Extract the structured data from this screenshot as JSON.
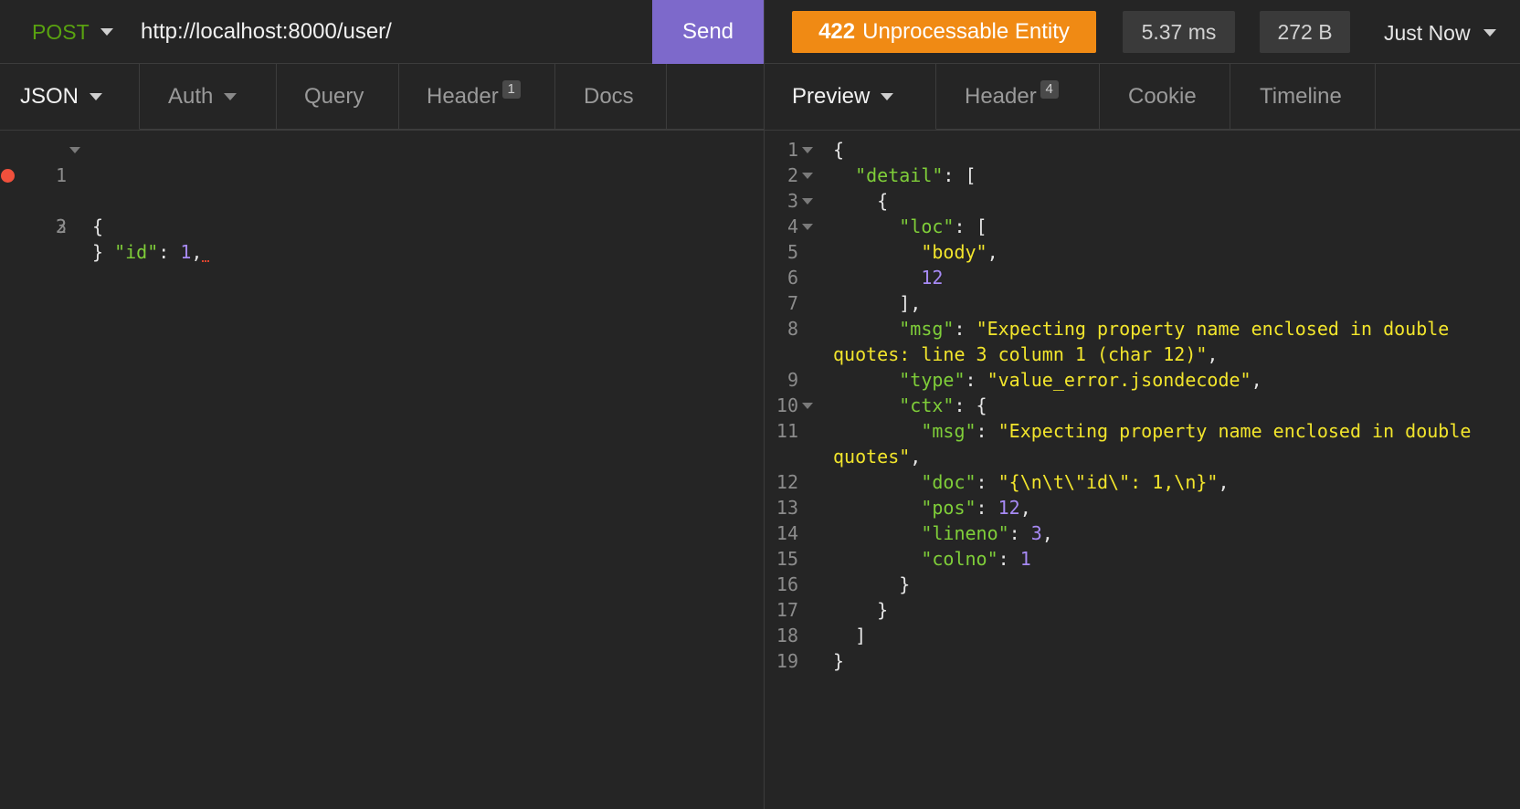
{
  "request": {
    "method": "POST",
    "url": "http://localhost:8000/user/",
    "send_label": "Send",
    "tabs": [
      {
        "label": "JSON"
      },
      {
        "label": "Auth"
      },
      {
        "label": "Query"
      },
      {
        "label": "Header",
        "badge": "1"
      },
      {
        "label": "Docs"
      }
    ],
    "body_lines": [
      {
        "num": "1",
        "text": "{"
      },
      {
        "num": "2",
        "key": "\"id\"",
        "sep": ": ",
        "value": "1",
        "trail": ","
      },
      {
        "num": "3",
        "text": "}"
      }
    ]
  },
  "response": {
    "status_code": "422",
    "status_text": "Unprocessable Entity",
    "time": "5.37 ms",
    "size": "272 B",
    "history": "Just Now",
    "tabs": [
      {
        "label": "Preview"
      },
      {
        "label": "Header",
        "badge": "4"
      },
      {
        "label": "Cookie"
      },
      {
        "label": "Timeline"
      }
    ],
    "lines": [
      {
        "num": "1",
        "fold": true,
        "indent": "",
        "parts": [
          [
            "p",
            "{"
          ]
        ]
      },
      {
        "num": "2",
        "fold": true,
        "indent": "  ",
        "parts": [
          [
            "k",
            "\"detail\""
          ],
          [
            "p",
            ": ["
          ]
        ]
      },
      {
        "num": "3",
        "fold": true,
        "indent": "    ",
        "parts": [
          [
            "p",
            "{"
          ]
        ]
      },
      {
        "num": "4",
        "fold": true,
        "indent": "      ",
        "parts": [
          [
            "k",
            "\"loc\""
          ],
          [
            "p",
            ": ["
          ]
        ]
      },
      {
        "num": "5",
        "fold": false,
        "indent": "        ",
        "parts": [
          [
            "s",
            "\"body\""
          ],
          [
            "p",
            ","
          ]
        ]
      },
      {
        "num": "6",
        "fold": false,
        "indent": "        ",
        "parts": [
          [
            "n",
            "12"
          ]
        ]
      },
      {
        "num": "7",
        "fold": false,
        "indent": "      ",
        "parts": [
          [
            "p",
            "],"
          ]
        ]
      },
      {
        "num": "8",
        "fold": false,
        "indent": "      ",
        "parts": [
          [
            "k",
            "\"msg\""
          ],
          [
            "p",
            ": "
          ],
          [
            "s",
            "\"Expecting property name enclosed in double"
          ]
        ]
      },
      {
        "num": "",
        "fold": false,
        "indent": "",
        "parts": [
          [
            "s",
            "quotes: line 3 column 1 (char 12)\""
          ],
          [
            "p",
            ","
          ]
        ]
      },
      {
        "num": "9",
        "fold": false,
        "indent": "      ",
        "parts": [
          [
            "k",
            "\"type\""
          ],
          [
            "p",
            ": "
          ],
          [
            "s",
            "\"value_error.jsondecode\""
          ],
          [
            "p",
            ","
          ]
        ]
      },
      {
        "num": "10",
        "fold": true,
        "indent": "      ",
        "parts": [
          [
            "k",
            "\"ctx\""
          ],
          [
            "p",
            ": {"
          ]
        ]
      },
      {
        "num": "11",
        "fold": false,
        "indent": "        ",
        "parts": [
          [
            "k",
            "\"msg\""
          ],
          [
            "p",
            ": "
          ],
          [
            "s",
            "\"Expecting property name enclosed in double"
          ]
        ]
      },
      {
        "num": "",
        "fold": false,
        "indent": "",
        "parts": [
          [
            "s",
            "quotes\""
          ],
          [
            "p",
            ","
          ]
        ]
      },
      {
        "num": "12",
        "fold": false,
        "indent": "        ",
        "parts": [
          [
            "k",
            "\"doc\""
          ],
          [
            "p",
            ": "
          ],
          [
            "s",
            "\"{\\n\\t\\\"id\\\": 1,\\n}\""
          ],
          [
            "p",
            ","
          ]
        ]
      },
      {
        "num": "13",
        "fold": false,
        "indent": "        ",
        "parts": [
          [
            "k",
            "\"pos\""
          ],
          [
            "p",
            ": "
          ],
          [
            "n",
            "12"
          ],
          [
            "p",
            ","
          ]
        ]
      },
      {
        "num": "14",
        "fold": false,
        "indent": "        ",
        "parts": [
          [
            "k",
            "\"lineno\""
          ],
          [
            "p",
            ": "
          ],
          [
            "n",
            "3"
          ],
          [
            "p",
            ","
          ]
        ]
      },
      {
        "num": "15",
        "fold": false,
        "indent": "        ",
        "parts": [
          [
            "k",
            "\"colno\""
          ],
          [
            "p",
            ": "
          ],
          [
            "n",
            "1"
          ]
        ]
      },
      {
        "num": "16",
        "fold": false,
        "indent": "      ",
        "parts": [
          [
            "p",
            "}"
          ]
        ]
      },
      {
        "num": "17",
        "fold": false,
        "indent": "    ",
        "parts": [
          [
            "p",
            "}"
          ]
        ]
      },
      {
        "num": "18",
        "fold": false,
        "indent": "  ",
        "parts": [
          [
            "p",
            "]"
          ]
        ]
      },
      {
        "num": "19",
        "fold": false,
        "indent": "",
        "parts": [
          [
            "p",
            "}"
          ]
        ]
      }
    ]
  },
  "colors": {
    "method": "#59a210",
    "send": "#7d69cb",
    "status": "#f08a14",
    "key": "#7fce39",
    "string": "#f2e52c",
    "number": "#a78af5",
    "error_dot": "#f0503c"
  }
}
